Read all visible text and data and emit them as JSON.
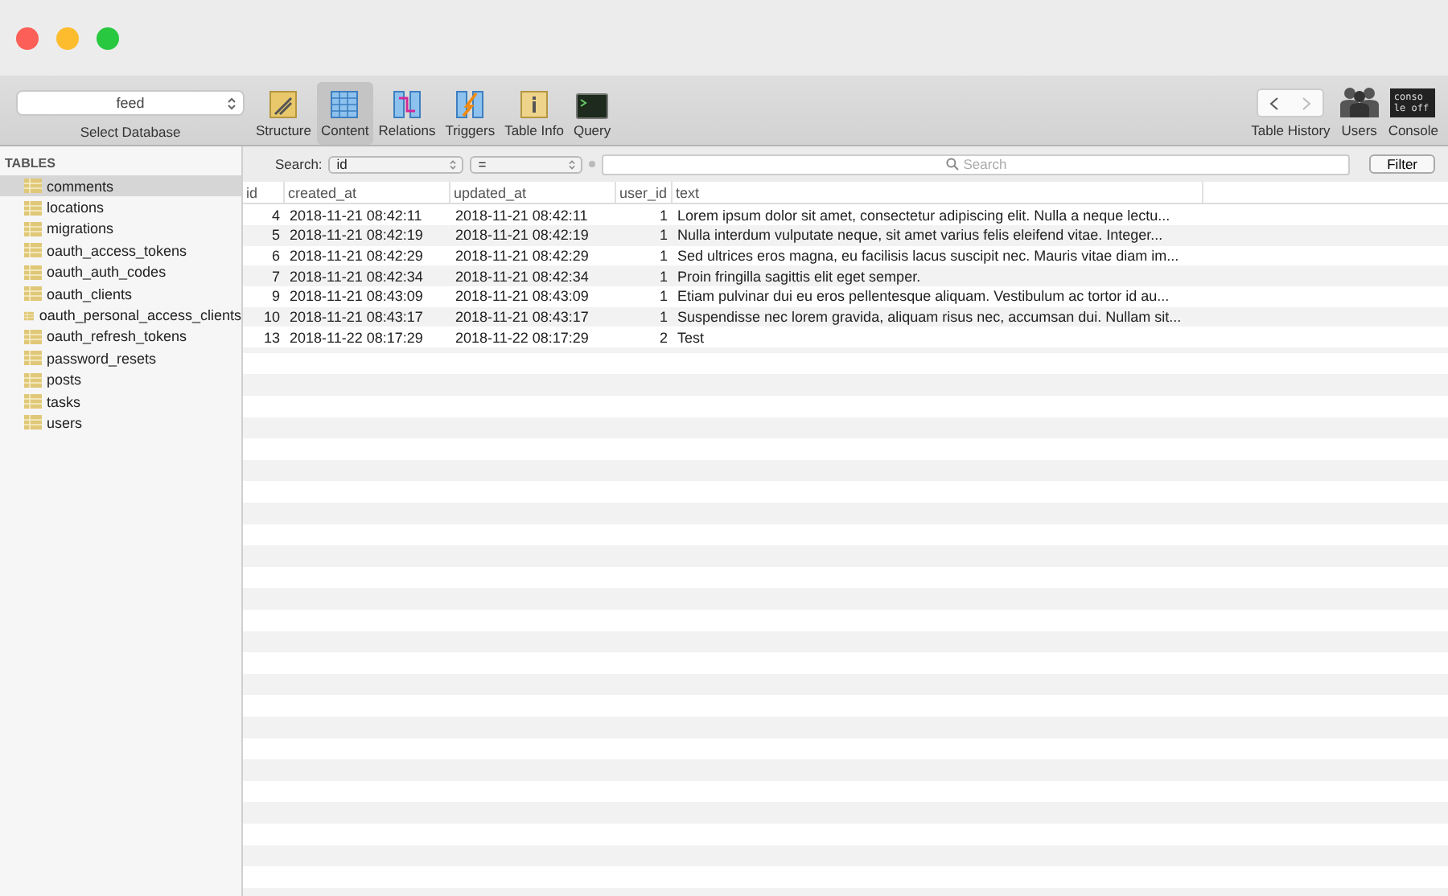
{
  "database_selector": {
    "value": "feed",
    "label": "Select Database"
  },
  "toolbar": [
    {
      "label": "Structure",
      "selected": false
    },
    {
      "label": "Content",
      "selected": true
    },
    {
      "label": "Relations",
      "selected": false
    },
    {
      "label": "Triggers",
      "selected": false
    },
    {
      "label": "Table Info",
      "selected": false
    },
    {
      "label": "Query",
      "selected": false
    }
  ],
  "history": {
    "label": "Table History"
  },
  "right_tools": [
    {
      "label": "Users"
    },
    {
      "label": "Console",
      "icon_text": "conso le off"
    }
  ],
  "sidebar": {
    "heading": "TABLES",
    "items": [
      {
        "name": "comments",
        "selected": true
      },
      {
        "name": "locations",
        "selected": false
      },
      {
        "name": "migrations",
        "selected": false
      },
      {
        "name": "oauth_access_tokens",
        "selected": false
      },
      {
        "name": "oauth_auth_codes",
        "selected": false
      },
      {
        "name": "oauth_clients",
        "selected": false
      },
      {
        "name": "oauth_personal_access_clients",
        "selected": false
      },
      {
        "name": "oauth_refresh_tokens",
        "selected": false
      },
      {
        "name": "password_resets",
        "selected": false
      },
      {
        "name": "posts",
        "selected": false
      },
      {
        "name": "tasks",
        "selected": false
      },
      {
        "name": "users",
        "selected": false
      }
    ]
  },
  "search_bar": {
    "label": "Search:",
    "field": "id",
    "operator": "=",
    "placeholder": "Search",
    "button": "Filter"
  },
  "table": {
    "columns": [
      "id",
      "created_at",
      "updated_at",
      "user_id",
      "text"
    ],
    "rows": [
      [
        "4",
        "2018-11-21 08:42:11",
        "2018-11-21 08:42:11",
        "1",
        "Lorem ipsum dolor sit amet, consectetur adipiscing elit. Nulla a neque lectu..."
      ],
      [
        "5",
        "2018-11-21 08:42:19",
        "2018-11-21 08:42:19",
        "1",
        "Nulla interdum vulputate neque, sit amet varius felis eleifend vitae. Integer..."
      ],
      [
        "6",
        "2018-11-21 08:42:29",
        "2018-11-21 08:42:29",
        "1",
        "Sed ultrices eros magna, eu facilisis lacus suscipit nec. Mauris vitae diam im..."
      ],
      [
        "7",
        "2018-11-21 08:42:34",
        "2018-11-21 08:42:34",
        "1",
        "Proin fringilla sagittis elit eget semper."
      ],
      [
        "9",
        "2018-11-21 08:43:09",
        "2018-11-21 08:43:09",
        "1",
        "Etiam pulvinar dui eu eros pellentesque aliquam. Vestibulum ac tortor id au..."
      ],
      [
        "10",
        "2018-11-21 08:43:17",
        "2018-11-21 08:43:17",
        "1",
        "Suspendisse nec lorem gravida, aliquam risus nec, accumsan dui. Nullam sit..."
      ],
      [
        "13",
        "2018-11-22 08:17:29",
        "2018-11-22 08:17:29",
        "2",
        "Test"
      ]
    ]
  }
}
